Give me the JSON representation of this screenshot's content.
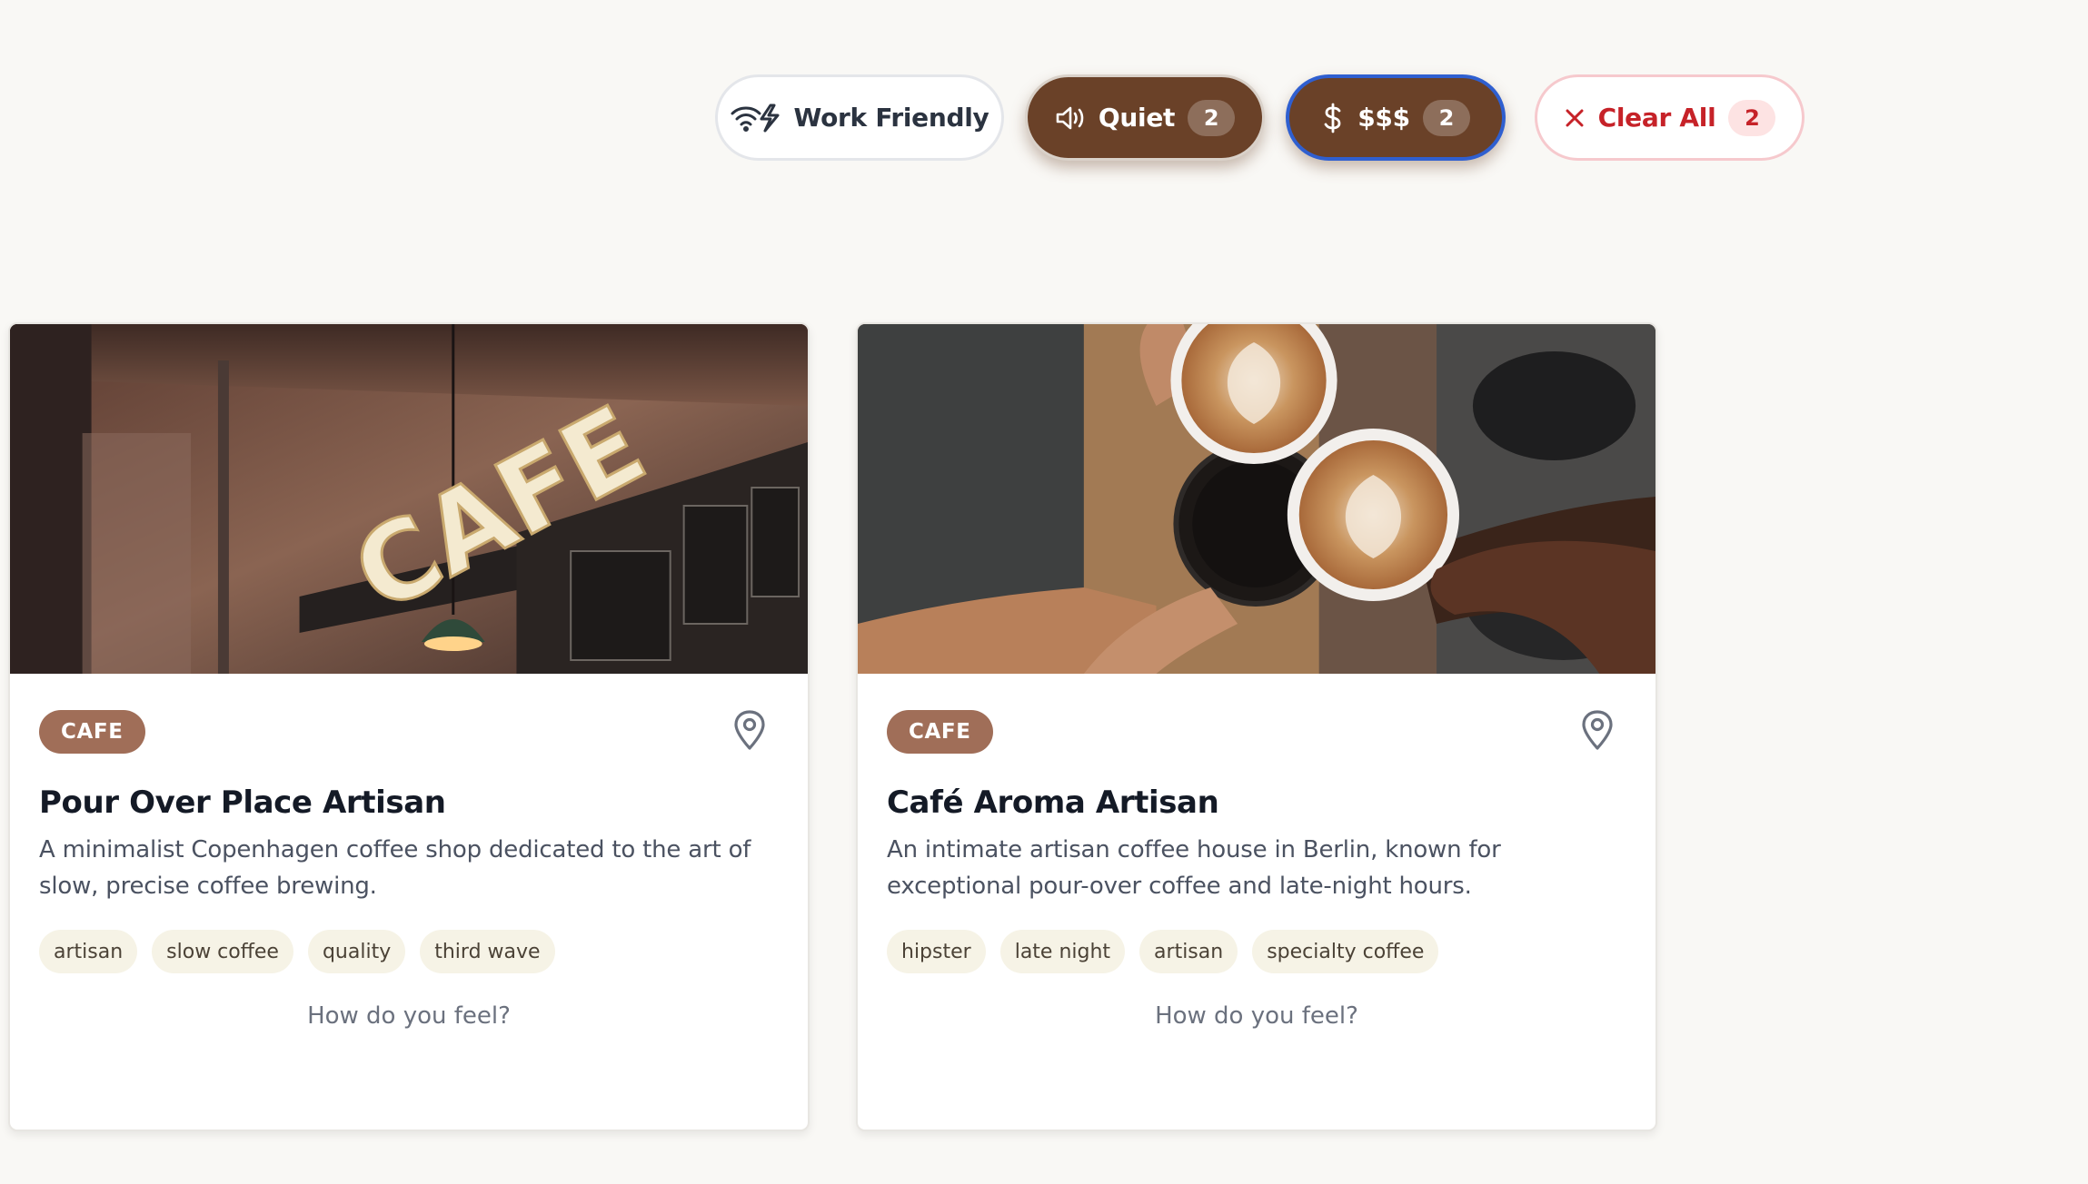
{
  "filters": {
    "work_friendly": {
      "label": "Work Friendly",
      "icon": "wifi-bolt-icon"
    },
    "quiet": {
      "label": "Quiet",
      "count": "2",
      "icon": "speaker-quiet-icon"
    },
    "price": {
      "label": "$$$",
      "count": "2",
      "icon": "dollar-icon"
    },
    "clear_all": {
      "label": "Clear All",
      "count": "2",
      "icon": "close-icon"
    }
  },
  "cards": [
    {
      "badge": "CAFE",
      "title": "Pour Over Place Artisan",
      "description": "A minimalist Copenhagen coffee shop dedicated to the art of slow, precise coffee brewing.",
      "tags": [
        "artisan",
        "slow coffee",
        "quality",
        "third wave"
      ],
      "feel_prompt": "How do you feel?",
      "photo_sign_text": "CAFE"
    },
    {
      "badge": "CAFE",
      "title": "Café Aroma Artisan",
      "description": "An intimate artisan coffee house in Berlin, known for exceptional pour-over coffee and late-night hours.",
      "tags": [
        "hipster",
        "late night",
        "artisan",
        "specialty coffee"
      ],
      "feel_prompt": "How do you feel?"
    }
  ],
  "colors": {
    "page_bg": "#f9f8f5",
    "brown_active": "#6a4128",
    "badge_brown": "#a06e58",
    "focus_blue": "#2f5fd0",
    "clear_red": "#c62228",
    "tag_bg": "#f6f3e6"
  }
}
